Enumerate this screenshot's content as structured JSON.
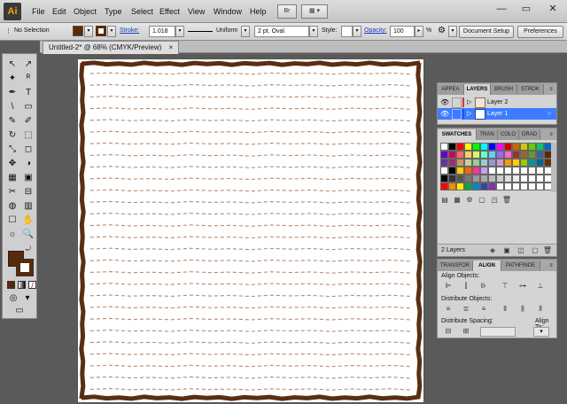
{
  "app": {
    "logo_text": "Ai"
  },
  "menu": [
    "File",
    "Edit",
    "Object",
    "Type",
    "Select",
    "Effect",
    "View",
    "Window",
    "Help"
  ],
  "menu_right": {
    "bridge": "Br",
    "arrange": "▦"
  },
  "window_controls": {
    "minimize": "—",
    "maximize": "▭",
    "close": "✕"
  },
  "control_bar": {
    "selection": "No Selection",
    "stroke_label": "Stroke:",
    "stroke_value": "1.018",
    "profile_label": "Uniform",
    "brush_value": "2 pt. Oval",
    "style_label": "Style:",
    "opacity_label": "Opacity:",
    "opacity_value": "100",
    "percent": "%",
    "doc_setup_button": "Document Setup",
    "preferences_button": "Preferences",
    "fill_color": "#5a2a0a",
    "stroke_color": "#5a2a0a"
  },
  "document": {
    "tab_title": "Untitled-2* @ 68% (CMYK/Preview)",
    "close": "×",
    "frame_color": "#5a2e12",
    "dash_color": "#b58b70"
  },
  "tools": [
    [
      "↖",
      "↗"
    ],
    [
      "✦",
      "ᴿ"
    ],
    [
      "✒",
      "T"
    ],
    [
      "\\",
      "▭"
    ],
    [
      "✎",
      "✐"
    ],
    [
      "↻",
      "⬚"
    ],
    [
      "⤡",
      "◻"
    ],
    [
      "✥",
      "◑"
    ],
    [
      "▦",
      "▣"
    ],
    [
      "✂",
      "⊟"
    ],
    [
      "◍",
      "▥"
    ],
    [
      "☐",
      "✋"
    ],
    [
      "☼",
      "🔍"
    ]
  ],
  "layers_panel": {
    "tabs": [
      "APPEA",
      "LAYERS",
      "BRUSH",
      "STROK"
    ],
    "active_tab": "LAYERS",
    "layers": [
      {
        "name": "Layer 2",
        "selected": false,
        "color": "#e03030"
      },
      {
        "name": "Layer 1",
        "selected": true,
        "color": "#3070ff"
      }
    ],
    "footer_count": "2 Layers"
  },
  "swatches_panel": {
    "tabs": [
      "SWATCHES",
      "TRAN",
      "COLO",
      "GRAD"
    ],
    "active_tab": "SWATCHES",
    "colors": [
      "#ffffff",
      "#000000",
      "#ff0000",
      "#ffff00",
      "#00ff00",
      "#00ffff",
      "#0000ff",
      "#ff00ff",
      "#cc0000",
      "#cc6600",
      "#cccc00",
      "#66cc00",
      "#00cc66",
      "#0066cc",
      "#6600cc",
      "#cc0066",
      "#ff6666",
      "#ffcc66",
      "#ccff66",
      "#66ffcc",
      "#66ccff",
      "#9966ff",
      "#ff66cc",
      "#993333",
      "#996633",
      "#669933",
      "#336699",
      "#5a2a0a",
      "#663399",
      "#993366",
      "#cc9966",
      "#cccc99",
      "#99cc99",
      "#99cccc",
      "#9999cc",
      "#cc99cc",
      "#ff9900",
      "#ffcc00",
      "#99cc00",
      "#009999",
      "#006699",
      "#663300",
      "#ffffff",
      "#000000",
      "#ffcc00",
      "#ff6600",
      "#ff3399",
      "#cc99ff",
      "#ffffff",
      "#ffffff",
      "#ffffff",
      "#ffffff",
      "#ffffff",
      "#ffffff",
      "#ffffff",
      "#ffffff",
      "#000000",
      "#333333",
      "#555555",
      "#777777",
      "#999999",
      "#aaaaaa",
      "#bbbbbb",
      "#cccccc",
      "#dddddd",
      "#eeeeee",
      "#ffffff",
      "#ffffff",
      "#ffffff",
      "#ffffff",
      "#ff0000",
      "#ff8800",
      "#ffee00",
      "#00aa44",
      "#0088cc",
      "#3344aa",
      "#8833aa",
      "#ffffff",
      "#ffffff",
      "#ffffff",
      "#ffffff",
      "#ffffff",
      "#ffffff",
      "#ffffff"
    ]
  },
  "align_panel": {
    "tabs": [
      "TRANSFOR",
      "ALIGN",
      "PATHFINDE"
    ],
    "active_tab": "ALIGN",
    "align_objects_label": "Align Objects:",
    "distribute_objects_label": "Distribute Objects:",
    "distribute_spacing_label": "Distribute Spacing:",
    "align_to_label": "Align To:"
  }
}
